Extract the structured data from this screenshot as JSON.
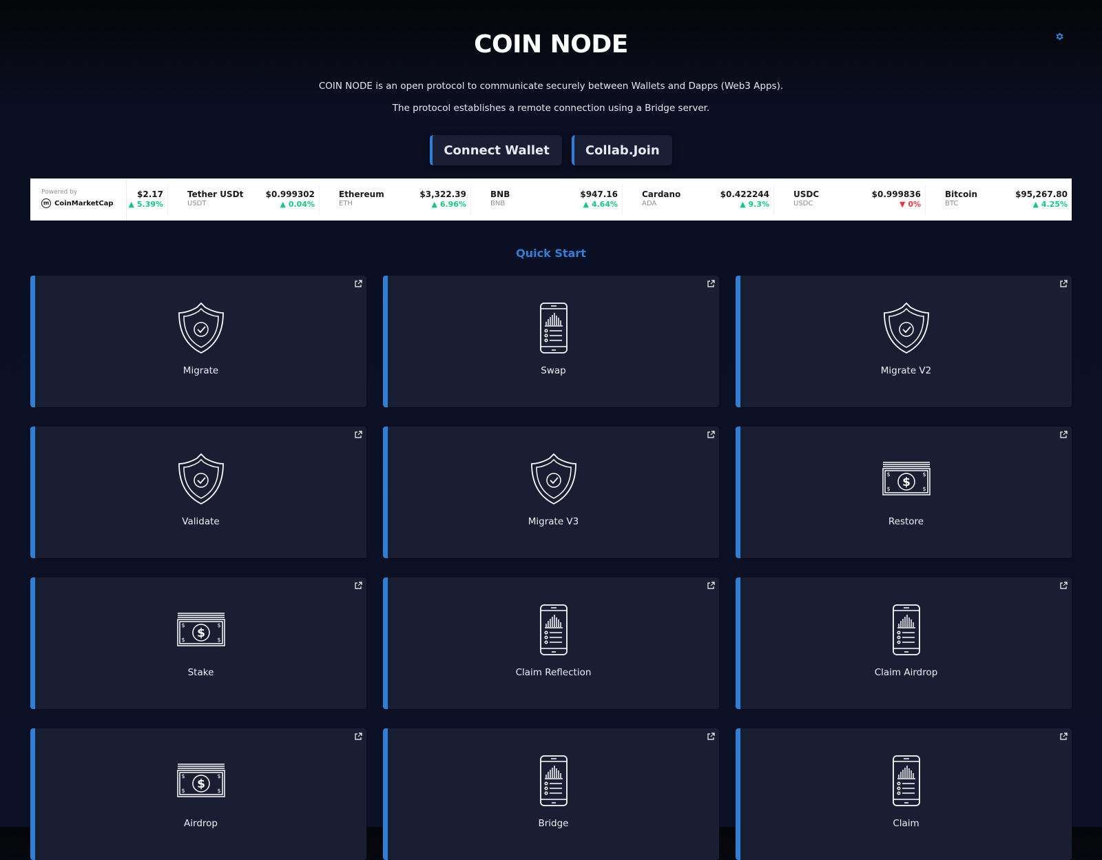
{
  "header": {
    "title": "COIN NODE",
    "description": "COIN NODE is an open protocol to communicate securely between Wallets and Dapps (Web3 Apps).",
    "description2": "The protocol establishes a remote connection using a Bridge server.",
    "settings_icon": "gear-icon"
  },
  "buttons": {
    "connect": "Connect Wallet",
    "collab": "Collab.Join"
  },
  "ticker": {
    "powered_by": "Powered by",
    "brand": "CoinMarketCap",
    "items": [
      {
        "name": "",
        "symbol": "",
        "price": "$2.17",
        "change": "5.39%",
        "dir": "up"
      },
      {
        "name": "Tether USDt",
        "symbol": "USDT",
        "price": "$0.999302",
        "change": "0.04%",
        "dir": "up"
      },
      {
        "name": "Ethereum",
        "symbol": "ETH",
        "price": "$3,322.39",
        "change": "6.96%",
        "dir": "up"
      },
      {
        "name": "BNB",
        "symbol": "BNB",
        "price": "$947.16",
        "change": "4.64%",
        "dir": "up"
      },
      {
        "name": "Cardano",
        "symbol": "ADA",
        "price": "$0.422244",
        "change": "9.3%",
        "dir": "up"
      },
      {
        "name": "USDC",
        "symbol": "USDC",
        "price": "$0.999836",
        "change": "0%",
        "dir": "down"
      },
      {
        "name": "Bitcoin",
        "symbol": "BTC",
        "price": "$95,267.80",
        "change": "4.25%",
        "dir": "up"
      }
    ]
  },
  "quick_start": {
    "title": "Quick Start",
    "cards": [
      {
        "label": "Migrate",
        "icon": "shield-check-icon"
      },
      {
        "label": "Swap",
        "icon": "phone-chart-icon"
      },
      {
        "label": "Migrate V2",
        "icon": "shield-check-icon"
      },
      {
        "label": "Validate",
        "icon": "shield-check-icon"
      },
      {
        "label": "Migrate V3",
        "icon": "shield-check-icon"
      },
      {
        "label": "Restore",
        "icon": "money-bill-icon"
      },
      {
        "label": "Stake",
        "icon": "money-bill-icon"
      },
      {
        "label": "Claim Reflection",
        "icon": "phone-chart-icon"
      },
      {
        "label": "Claim Airdrop",
        "icon": "phone-chart-icon"
      },
      {
        "label": "Airdrop",
        "icon": "money-bill-icon"
      },
      {
        "label": "Bridge",
        "icon": "phone-chart-icon"
      },
      {
        "label": "Claim",
        "icon": "phone-chart-icon"
      }
    ]
  },
  "colors": {
    "accent": "#2f7fd4",
    "up": "#16c784",
    "down": "#ea3943",
    "card": "#1a1e33"
  }
}
